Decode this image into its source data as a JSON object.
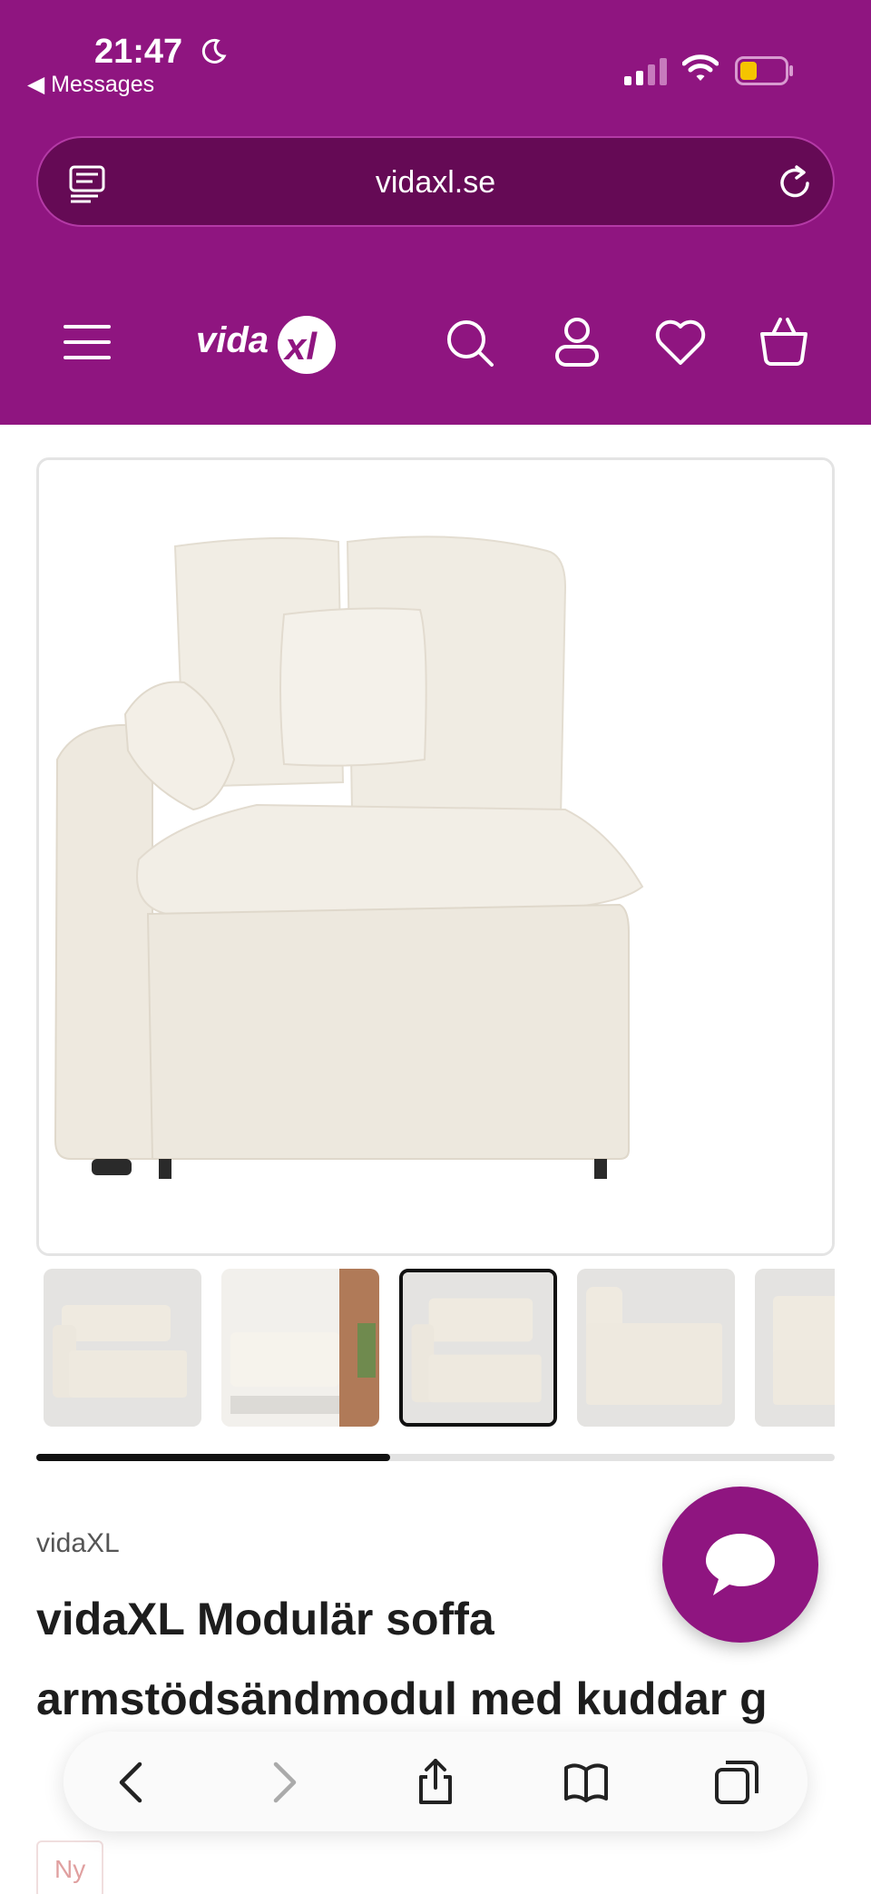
{
  "status_bar": {
    "time": "21:47",
    "back_app": "◀ Messages"
  },
  "browser": {
    "url": "vidaxl.se"
  },
  "header": {
    "logo_text": "vidaXL",
    "brand_color": "#8f1580"
  },
  "gallery": {
    "selected_index": 2,
    "thumbnail_count_visible": 5,
    "scroll_progress": 0.44
  },
  "product": {
    "brand": "vidaXL",
    "title": "vidaXL Modulär soffa armstödsändmodul med kuddar g",
    "badge": "Ny"
  },
  "icons": {
    "menu": "menu-icon",
    "search": "search-icon",
    "account": "account-icon",
    "wishlist": "heart-icon",
    "cart": "basket-icon",
    "chat": "chat-icon",
    "back": "chevron-left-icon",
    "forward": "chevron-right-icon",
    "share": "share-icon",
    "bookmarks": "book-icon",
    "tabs": "tabs-icon"
  }
}
